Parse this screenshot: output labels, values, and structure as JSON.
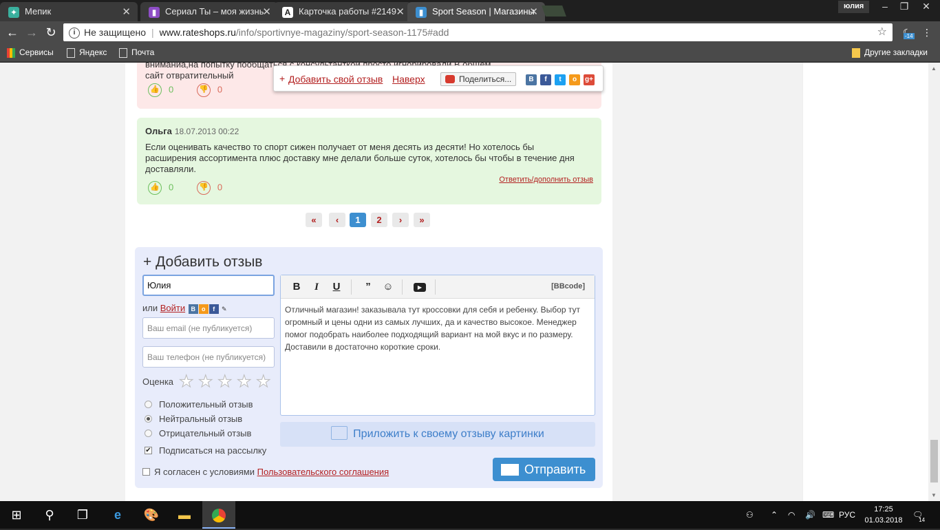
{
  "browser": {
    "tabs": [
      {
        "title": "Мепик",
        "icon": "mepik-icon",
        "color": "#3ab09e"
      },
      {
        "title": "Сериал Ты – моя жизнь",
        "icon": "serial-icon",
        "color": "#8e4ec6"
      },
      {
        "title": "Карточка работы #2149",
        "icon": "a-icon",
        "color": "#222222"
      },
      {
        "title": "Sport Season | Магазины",
        "icon": "chart-icon",
        "color": "#3d8fd0"
      }
    ],
    "profile": "юлия",
    "security": "Не защищено",
    "url_host": "www.rateshops.ru",
    "url_path": "/info/sportivnye-magaziny/sport-season-1175#add",
    "ext_badge": "-14",
    "bookmarks": {
      "apps": "Сервисы",
      "yandex": "Яндекс",
      "mail": "Почта",
      "other": "Другие закладки"
    }
  },
  "page": {
    "review1": {
      "text": "вниманиа,на попытку пообщаться с консультанткой просто игнорировали.В общем сайт отвратительный",
      "likes": "0",
      "dislikes": "0"
    },
    "floatbar": {
      "add": "Добавить свой отзыв",
      "add_prefix": "+",
      "top": "Наверх",
      "share": "Поделиться..."
    },
    "review2": {
      "author": "Ольга",
      "date": "18.07.2013 00:22",
      "text": "Если оценивать качество то спорт сижен получает от меня десять из десяти! Но хотелось бы расширения ассортимента плюс доставку мне делали больше суток, хотелось бы чтобы в течение дня доставляли.",
      "likes": "0",
      "dislikes": "0",
      "reply": "Ответить/дополнить отзыв"
    },
    "pager": {
      "first": "«",
      "prev": "‹",
      "p1": "1",
      "p2": "2",
      "next": "›",
      "last": "»"
    },
    "form": {
      "title": "+ Добавить отзыв",
      "name_value": "Юлия",
      "or": "или",
      "login": "Войти",
      "email_placeholder": "Ваш email (не публикуется)",
      "phone_placeholder": "Ваш телефон (не публикуется)",
      "rating_label": "Оценка",
      "positive": "Положительный отзыв",
      "neutral": "Нейтральный отзыв",
      "negative": "Отрицательный отзыв",
      "subscribe": "Подписаться на рассылку",
      "agree_prefix": "Я согласен с условиями",
      "agree_link": "Пользовательского соглашения",
      "bbcode": "[BBcode]",
      "editor_text": "Отличный магазин! заказывала тут кроссовки для себя и ребенку. Выбор тут огромный и цены одни из самых лучших, да и качество высокое. Менеджер помог подобрать наиболее подходящий вариант на мой вкус и по размеру. Доставили в достаточно короткие сроки.",
      "attach": "Приложить к своему отзыву картинки",
      "send": "Отправить"
    }
  },
  "taskbar": {
    "lang": "РУС",
    "time": "17:25",
    "date": "01.03.2018",
    "notif": "14"
  }
}
